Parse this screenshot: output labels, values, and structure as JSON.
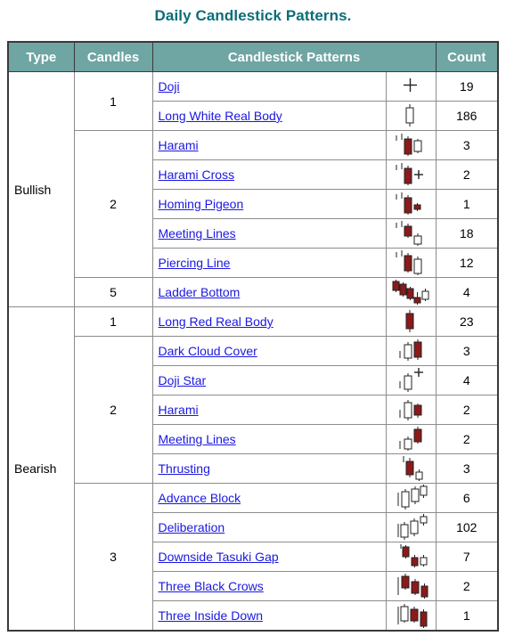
{
  "page": {
    "title": "Daily Candlestick Patterns.",
    "title_color": "#0a6e78"
  },
  "table": {
    "header_bg": "#6fa5a3",
    "link_color": "#1a18e0",
    "bullish_candle_color": "#ffffff",
    "bearish_candle_color": "#8b1a1a",
    "columns": [
      {
        "key": "type",
        "label": "Type"
      },
      {
        "key": "candles",
        "label": "Candles"
      },
      {
        "key": "pattern",
        "label": "Candlestick Patterns"
      },
      {
        "key": "count",
        "label": "Count"
      }
    ],
    "groups": [
      {
        "type": "Bullish",
        "subgroups": [
          {
            "candles": "1",
            "rows": [
              {
                "pattern": "Doji",
                "glyph": "doji-cross-icon",
                "count": "19"
              },
              {
                "pattern": "Long White Real Body",
                "glyph": "long-white-candle-icon",
                "count": "186"
              }
            ]
          },
          {
            "candles": "2",
            "rows": [
              {
                "pattern": "Harami",
                "glyph": "bullish-harami-icon",
                "count": "3"
              },
              {
                "pattern": "Harami Cross",
                "glyph": "bullish-harami-cross-icon",
                "count": "2"
              },
              {
                "pattern": "Homing Pigeon",
                "glyph": "homing-pigeon-icon",
                "count": "1"
              },
              {
                "pattern": "Meeting Lines",
                "glyph": "bullish-meeting-lines-icon",
                "count": "18"
              },
              {
                "pattern": "Piercing Line",
                "glyph": "piercing-line-icon",
                "count": "12"
              }
            ]
          },
          {
            "candles": "5",
            "rows": [
              {
                "pattern": "Ladder Bottom",
                "glyph": "ladder-bottom-icon",
                "count": "4"
              }
            ]
          }
        ]
      },
      {
        "type": "Bearish",
        "subgroups": [
          {
            "candles": "1",
            "rows": [
              {
                "pattern": "Long Red Real Body",
                "glyph": "long-red-candle-icon",
                "count": "23"
              }
            ]
          },
          {
            "candles": "2",
            "rows": [
              {
                "pattern": "Dark Cloud Cover",
                "glyph": "dark-cloud-cover-icon",
                "count": "3"
              },
              {
                "pattern": "Doji Star",
                "glyph": "bearish-doji-star-icon",
                "count": "4"
              },
              {
                "pattern": "Harami",
                "glyph": "bearish-harami-icon",
                "count": "2"
              },
              {
                "pattern": "Meeting Lines",
                "glyph": "bearish-meeting-lines-icon",
                "count": "2"
              },
              {
                "pattern": "Thrusting",
                "glyph": "thrusting-icon",
                "count": "3"
              }
            ]
          },
          {
            "candles": "3",
            "rows": [
              {
                "pattern": "Advance Block",
                "glyph": "advance-block-icon",
                "count": "6"
              },
              {
                "pattern": "Deliberation",
                "glyph": "deliberation-icon",
                "count": "102"
              },
              {
                "pattern": "Downside Tasuki Gap",
                "glyph": "downside-tasuki-gap-icon",
                "count": "7"
              },
              {
                "pattern": "Three Black Crows",
                "glyph": "three-black-crows-icon",
                "count": "2"
              },
              {
                "pattern": "Three Inside Down",
                "glyph": "three-inside-down-icon",
                "count": "1"
              }
            ]
          }
        ]
      }
    ]
  }
}
